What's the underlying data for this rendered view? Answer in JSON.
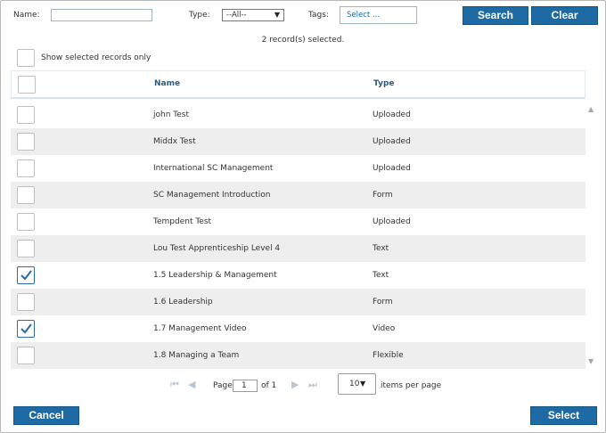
{
  "filters": {
    "name_label": "Name:",
    "name_value": "",
    "type_label": "Type:",
    "type_selected": "--All--",
    "tags_label": "Tags:",
    "tags_placeholder": "Select ..."
  },
  "buttons": {
    "search": "Search",
    "clear": "Clear",
    "cancel": "Cancel",
    "select": "Select"
  },
  "selected_count_text": "2 record(s) selected.",
  "show_selected_label": "Show selected records only",
  "columns": {
    "name": "Name",
    "type": "Type"
  },
  "rows": [
    {
      "name": "john Test",
      "type": "Uploaded",
      "checked": false
    },
    {
      "name": "Middx Test",
      "type": "Uploaded",
      "checked": false
    },
    {
      "name": "International SC Management",
      "type": "Uploaded",
      "checked": false
    },
    {
      "name": "SC Management Introduction",
      "type": "Form",
      "checked": false
    },
    {
      "name": "Tempdent Test",
      "type": "Uploaded",
      "checked": false
    },
    {
      "name": "Lou Test Apprenticeship Level 4",
      "type": "Text",
      "checked": false
    },
    {
      "name": "1.5 Leadership & Management",
      "type": "Text",
      "checked": true
    },
    {
      "name": "1.6 Leadership",
      "type": "Form",
      "checked": false
    },
    {
      "name": "1.7 Management Video",
      "type": "Video",
      "checked": true
    },
    {
      "name": "1.8 Managing a Team",
      "type": "Flexible",
      "checked": false
    }
  ],
  "pager": {
    "page_label": "Page",
    "page_value": "1",
    "of_label": "of 1",
    "page_size": "10",
    "items_per_page_label": "items per page"
  },
  "colors": {
    "accent": "#1e6aa4",
    "header_text": "#2b5c84",
    "row_alt": "#eeeeee"
  }
}
